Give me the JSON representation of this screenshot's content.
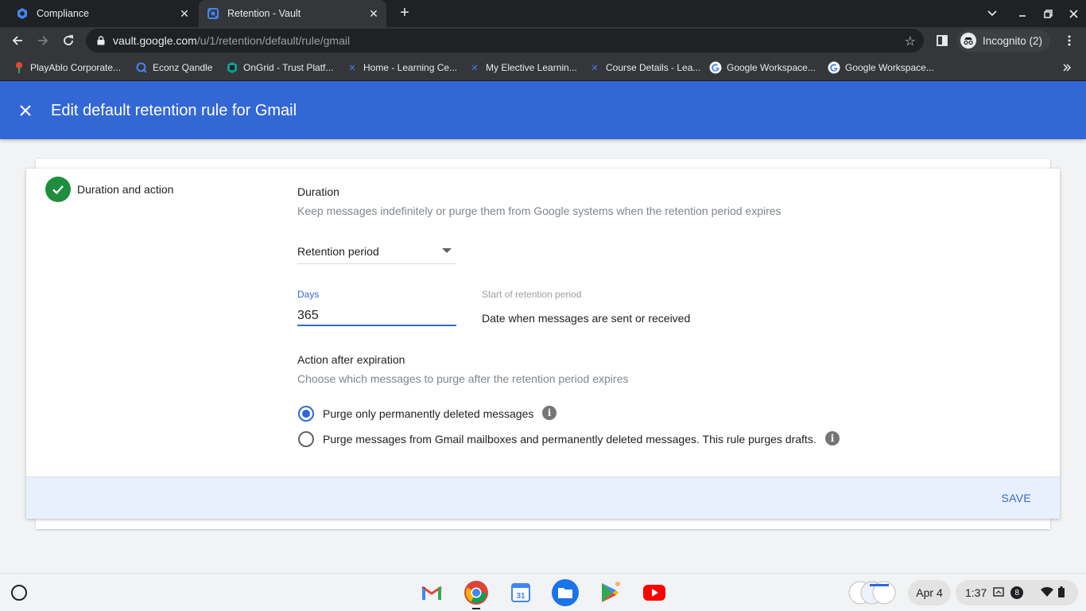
{
  "browser": {
    "tabs": [
      {
        "title": "Compliance",
        "active": false,
        "icon": "compliance-icon"
      },
      {
        "title": "Retention - Vault",
        "active": true,
        "icon": "vault-icon"
      }
    ],
    "url_host": "vault.google.com",
    "url_path": "/u/1/retention/default/rule/gmail",
    "profile_label": "Incognito (2)",
    "bookmarks": [
      {
        "label": "PlayAblo Corporate...",
        "icon": "playablo-icon"
      },
      {
        "label": "Econz Qandle",
        "icon": "qandle-icon"
      },
      {
        "label": "OnGrid - Trust Platf...",
        "icon": "ongrid-icon"
      },
      {
        "label": "Home - Learning Ce...",
        "icon": "x-learning-icon"
      },
      {
        "label": "My Elective Learnin...",
        "icon": "x-learning-icon"
      },
      {
        "label": "Course Details - Lea...",
        "icon": "x-learning-icon"
      },
      {
        "label": "Google Workspace...",
        "icon": "google-icon"
      },
      {
        "label": "Google Workspace...",
        "icon": "google-icon"
      }
    ]
  },
  "page": {
    "title": "Edit default retention rule for Gmail",
    "step_label": "Duration and action",
    "duration": {
      "heading": "Duration",
      "description": "Keep messages indefinitely or purge them from Google systems when the retention period expires",
      "select_value": "Retention period",
      "days_label": "Days",
      "days_value": "365",
      "start_label": "Start of retention period",
      "start_value": "Date when messages are sent or received"
    },
    "action": {
      "heading": "Action after expiration",
      "description": "Choose which messages to purge after the retention period expires",
      "options": [
        {
          "label": "Purge only permanently deleted messages",
          "selected": true
        },
        {
          "label": "Purge messages from Gmail mailboxes and permanently deleted messages. This rule purges drafts.",
          "selected": false
        }
      ]
    },
    "save_label": "SAVE"
  },
  "shelf": {
    "apps": [
      "gmail-icon",
      "chrome-icon",
      "calendar-icon",
      "files-icon",
      "play-store-icon",
      "youtube-icon"
    ],
    "calendar_day": "31",
    "date": "Apr 4",
    "time": "1:37",
    "notification_count": "8"
  },
  "colors": {
    "accent": "#3367d6",
    "success": "#1e8e3e",
    "footer_bg": "#e8f0fe"
  }
}
